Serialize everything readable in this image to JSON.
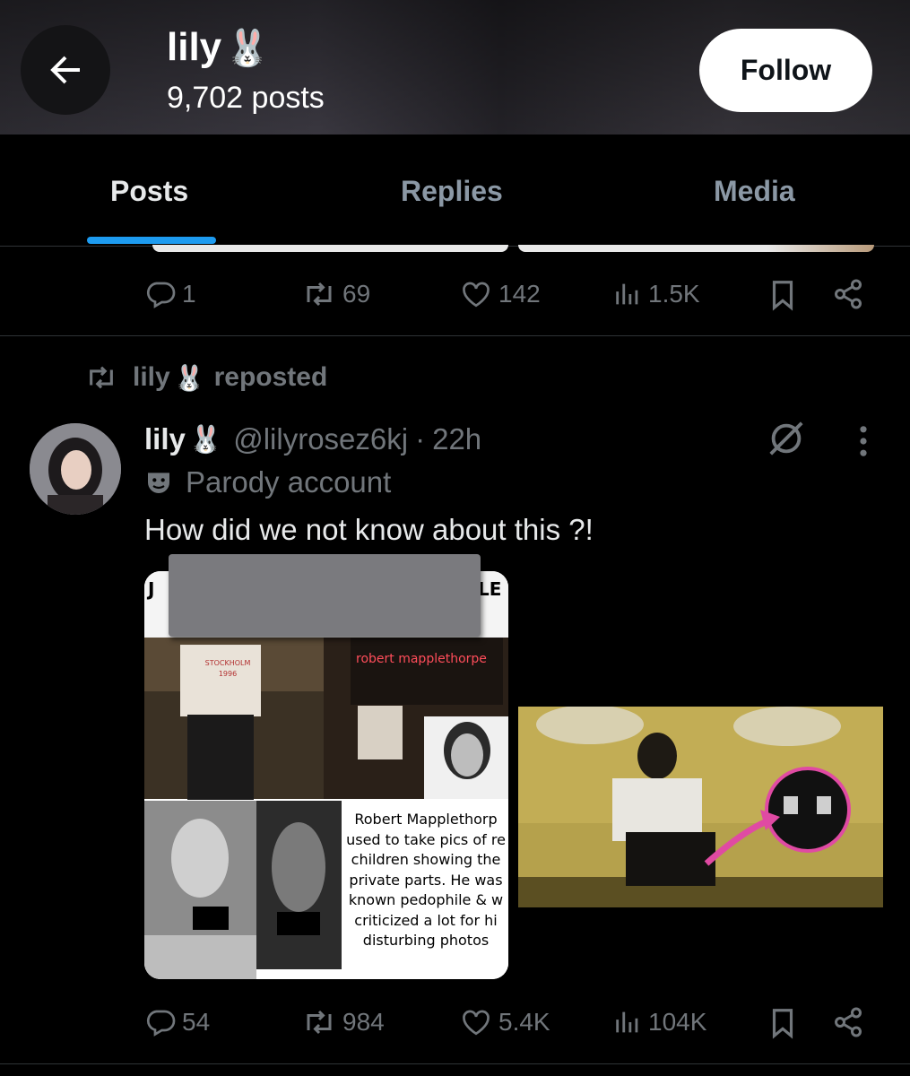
{
  "header": {
    "name": "lily",
    "name_emoji": "🐰",
    "post_count": "9,702 posts",
    "follow_label": "Follow"
  },
  "tabs": [
    {
      "label": "Posts",
      "active": true
    },
    {
      "label": "Replies",
      "active": false
    },
    {
      "label": "Media",
      "active": false
    }
  ],
  "prev_post": {
    "stats": {
      "replies": "1",
      "reposts": "69",
      "likes": "142",
      "views": "1.5K"
    }
  },
  "repost_banner": {
    "name": "lily",
    "suffix": "reposted"
  },
  "post": {
    "author_name": "lily",
    "handle": "@lilyrosez6kj",
    "separator": "·",
    "time": "22h",
    "label": "Parody account",
    "text": "How did we not know about this ?!",
    "stats": {
      "replies": "54",
      "reposts": "984",
      "likes": "5.4K",
      "views": "104K"
    }
  },
  "media": {
    "left_caption_top_left": "J",
    "left_caption_top_right": "LE",
    "left_label_red": "robert mapplethorpe",
    "left_caption_bottom": [
      "Robert Mapplethorp",
      "used to take pics of re",
      "children showing the",
      "private parts. He was",
      "known pedophile & w",
      "criticized a lot for hi",
      "disturbing photos"
    ],
    "shirt_text_line1": "STOCKHOLM",
    "shirt_text_line2": "1996"
  },
  "colors": {
    "accent": "#1d9bf0",
    "muted": "#71767b",
    "text": "#e7e9ea",
    "bg": "#000000",
    "divider": "#2f3336"
  },
  "icons": [
    "back-arrow-icon",
    "rabbit-emoji-icon",
    "reply-icon",
    "repost-icon",
    "like-icon",
    "views-icon",
    "bookmark-icon",
    "share-icon",
    "grok-icon",
    "more-icon",
    "parody-mask-icon"
  ]
}
